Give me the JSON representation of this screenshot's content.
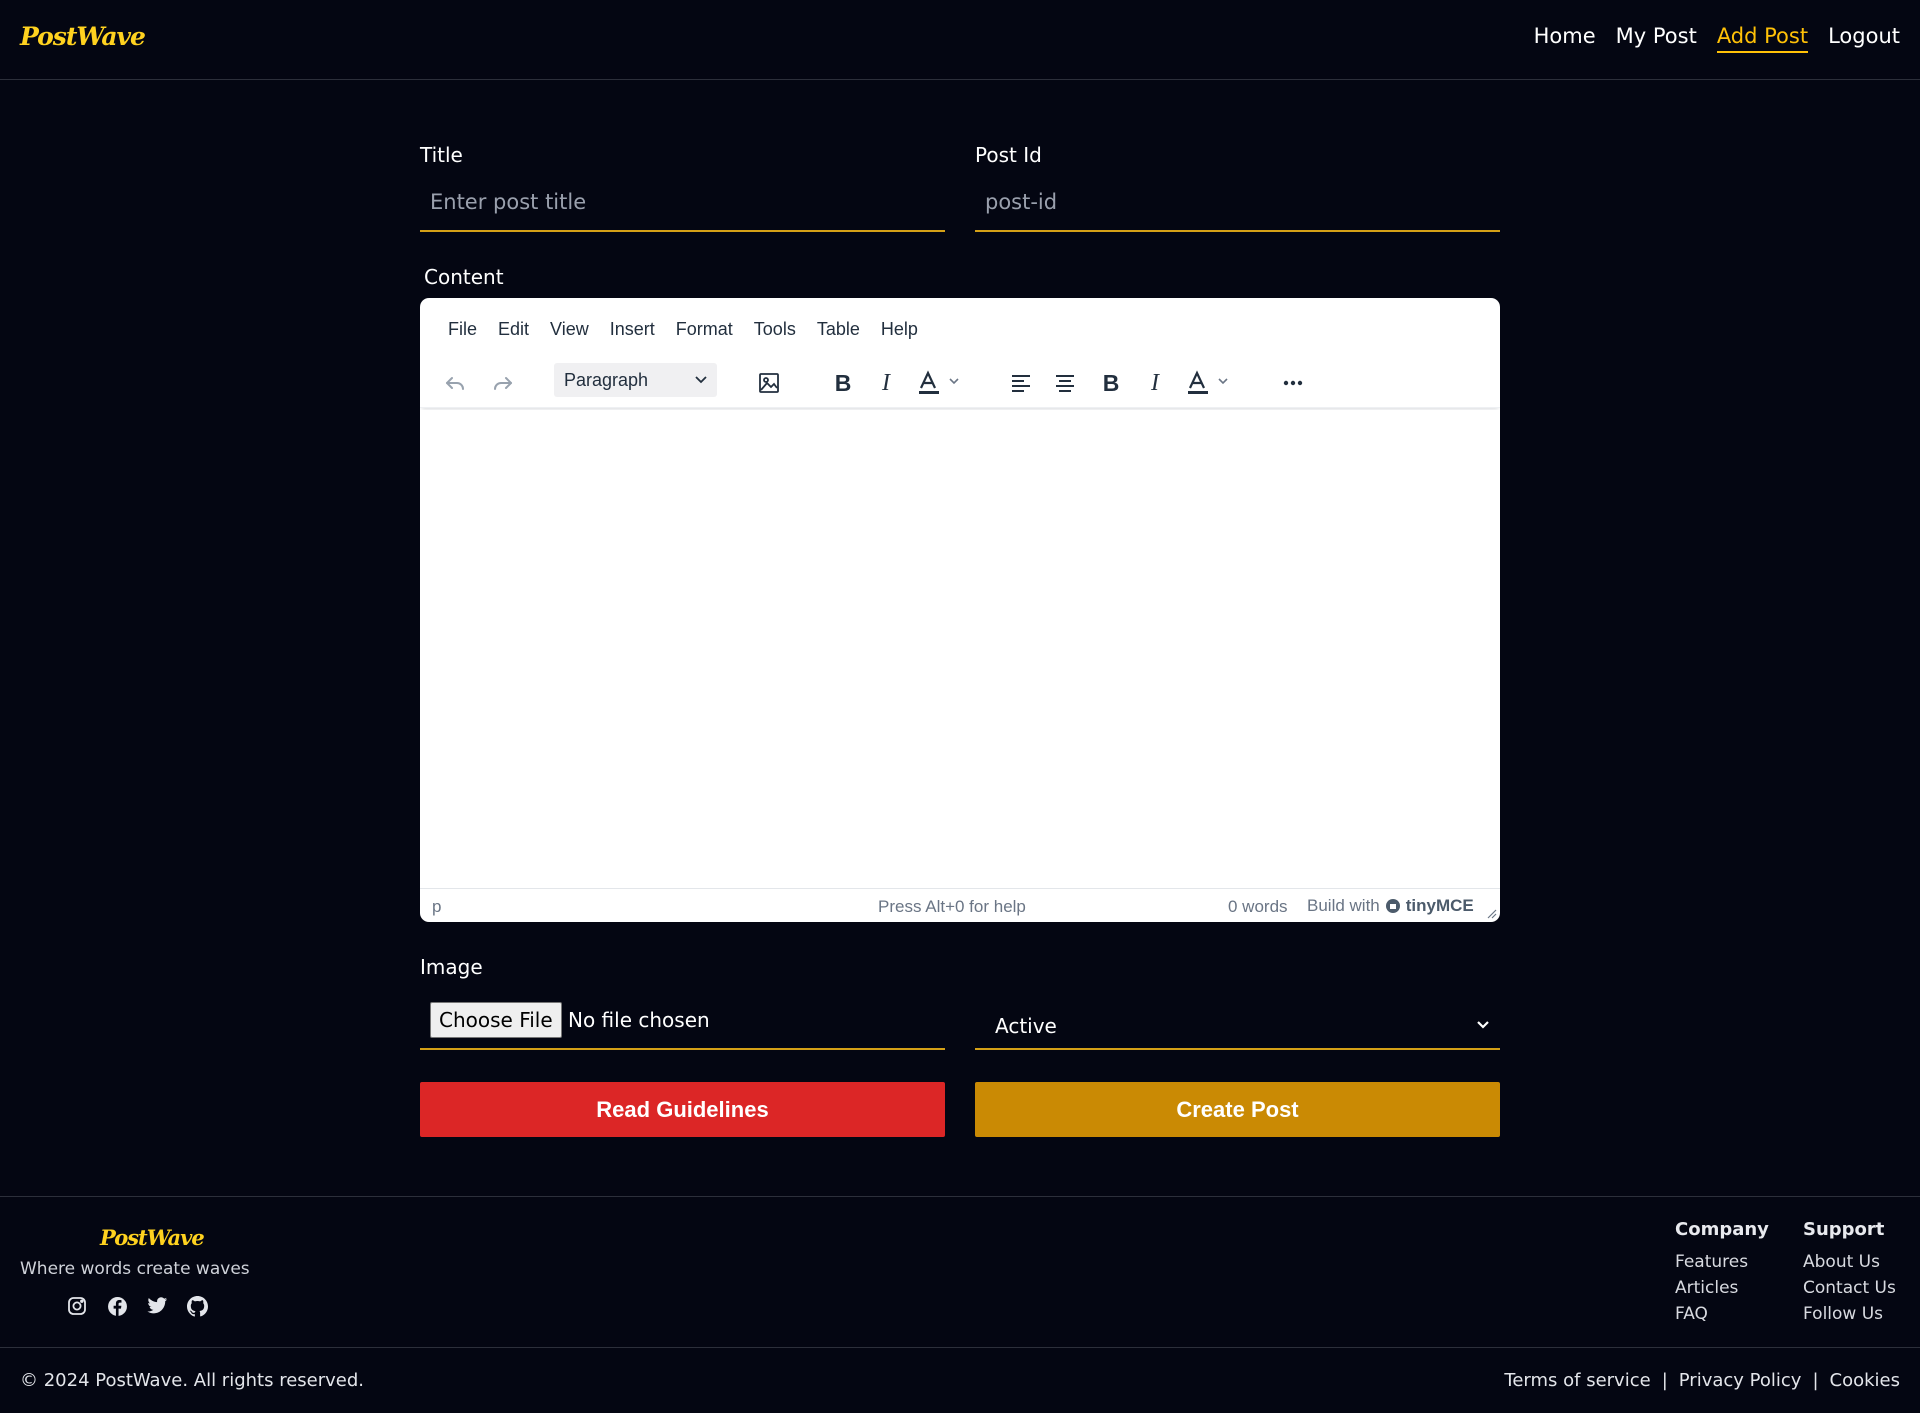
{
  "header": {
    "logo": "PostWave",
    "nav": [
      {
        "label": "Home",
        "active": false
      },
      {
        "label": "My Post",
        "active": false
      },
      {
        "label": "Add Post",
        "active": true
      },
      {
        "label": "Logout",
        "active": false
      }
    ]
  },
  "form": {
    "title_label": "Title",
    "title_placeholder": "Enter post title",
    "postid_label": "Post Id",
    "postid_placeholder": "post-id",
    "content_label": "Content",
    "image_label": "Image",
    "file_button": "Choose File",
    "file_status": "No file chosen",
    "status_value": "Active",
    "guidelines_button": "Read Guidelines",
    "create_button": "Create Post"
  },
  "editor": {
    "menus": [
      "File",
      "Edit",
      "View",
      "Insert",
      "Format",
      "Tools",
      "Table",
      "Help"
    ],
    "block_format": "Paragraph",
    "status_path": "p",
    "help_text": "Press Alt+0 for help",
    "word_count": "0 words",
    "build_with": "Build with",
    "brand": "tinyMCE"
  },
  "footer": {
    "logo": "PostWave",
    "tagline": "Where words create waves",
    "company": {
      "heading": "Company",
      "links": [
        "Features",
        "Articles",
        "FAQ"
      ]
    },
    "support": {
      "heading": "Support",
      "links": [
        "About Us",
        "Contact Us",
        "Follow Us"
      ]
    },
    "copyright": "© 2024 PostWave. All rights reserved.",
    "legal": [
      "Terms of service",
      "Privacy Policy",
      "Cookies"
    ],
    "legal_separator": "|"
  },
  "colors": {
    "background": "#040612",
    "accent": "#ffc107",
    "guidelines_button": "#dc2626",
    "create_button": "#ca8a04"
  }
}
